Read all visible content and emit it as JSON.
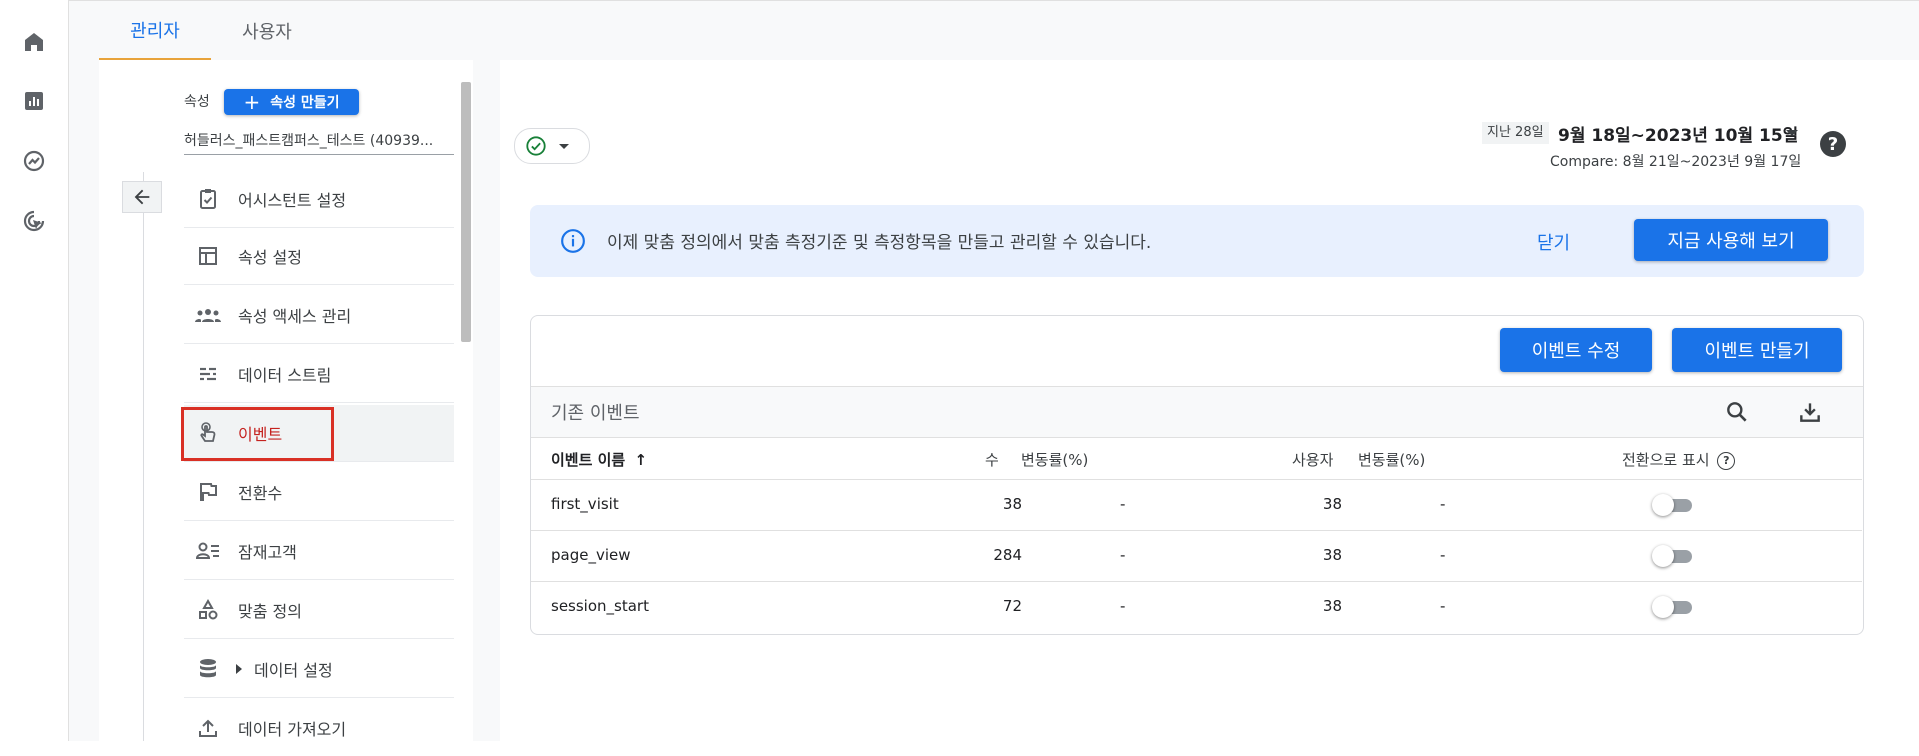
{
  "tabs": [
    {
      "label": "관리자",
      "active": true
    },
    {
      "label": "사용자",
      "active": false
    }
  ],
  "rail": [
    "home-icon",
    "reports-icon",
    "explore-icon",
    "advertising-icon"
  ],
  "property": {
    "label": "속성",
    "create_button": "속성 만들기",
    "selected": "허들러스_패스트캠퍼스_테스트 (40939..."
  },
  "nav": [
    {
      "label": "어시스턴트 설정",
      "icon": "assistant-icon"
    },
    {
      "label": "속성 설정",
      "icon": "property-settings-icon"
    },
    {
      "label": "속성 액세스 관리",
      "icon": "people-icon"
    },
    {
      "label": "데이터 스트림",
      "icon": "data-streams-icon"
    },
    {
      "label": "이벤트",
      "icon": "touch-icon",
      "active": true
    },
    {
      "label": "전환수",
      "icon": "flag-icon"
    },
    {
      "label": "잠재고객",
      "icon": "audience-icon"
    },
    {
      "label": "맞춤 정의",
      "icon": "custom-definitions-icon"
    },
    {
      "label": "데이터 설정",
      "icon": "database-icon"
    },
    {
      "label": "데이터 가져오기",
      "icon": "upload-icon"
    }
  ],
  "date_range": {
    "chip": "지난 28일",
    "range": "9월 18일~2023년 10월 15일",
    "compare": "Compare: 8월 21일~2023년 9월 17일"
  },
  "banner": {
    "text": "이제 맞춤 정의에서 맞춤 측정기준 및 측정항목을 만들고 관리할 수 있습니다.",
    "dismiss": "닫기",
    "try_now": "지금 사용해 보기"
  },
  "events": {
    "edit_button": "이벤트 수정",
    "create_button": "이벤트 만들기",
    "section_title": "기존 이벤트",
    "columns": {
      "name": "이벤트 이름",
      "count": "수",
      "count_change": "변동률(%)",
      "users": "사용자",
      "users_change": "변동률(%)",
      "conversion": "전환으로 표시"
    },
    "rows": [
      {
        "name": "first_visit",
        "count": "38",
        "count_change": "-",
        "users": "38",
        "users_change": "-",
        "conversion": false
      },
      {
        "name": "page_view",
        "count": "284",
        "count_change": "-",
        "users": "38",
        "users_change": "-",
        "conversion": false
      },
      {
        "name": "session_start",
        "count": "72",
        "count_change": "-",
        "users": "38",
        "users_change": "-",
        "conversion": false
      }
    ]
  },
  "colors": {
    "accent": "#1a73e8",
    "highlight_border": "#d93025",
    "active_tab_underline": "#e8a33a",
    "banner_bg": "#e8f0fe"
  }
}
